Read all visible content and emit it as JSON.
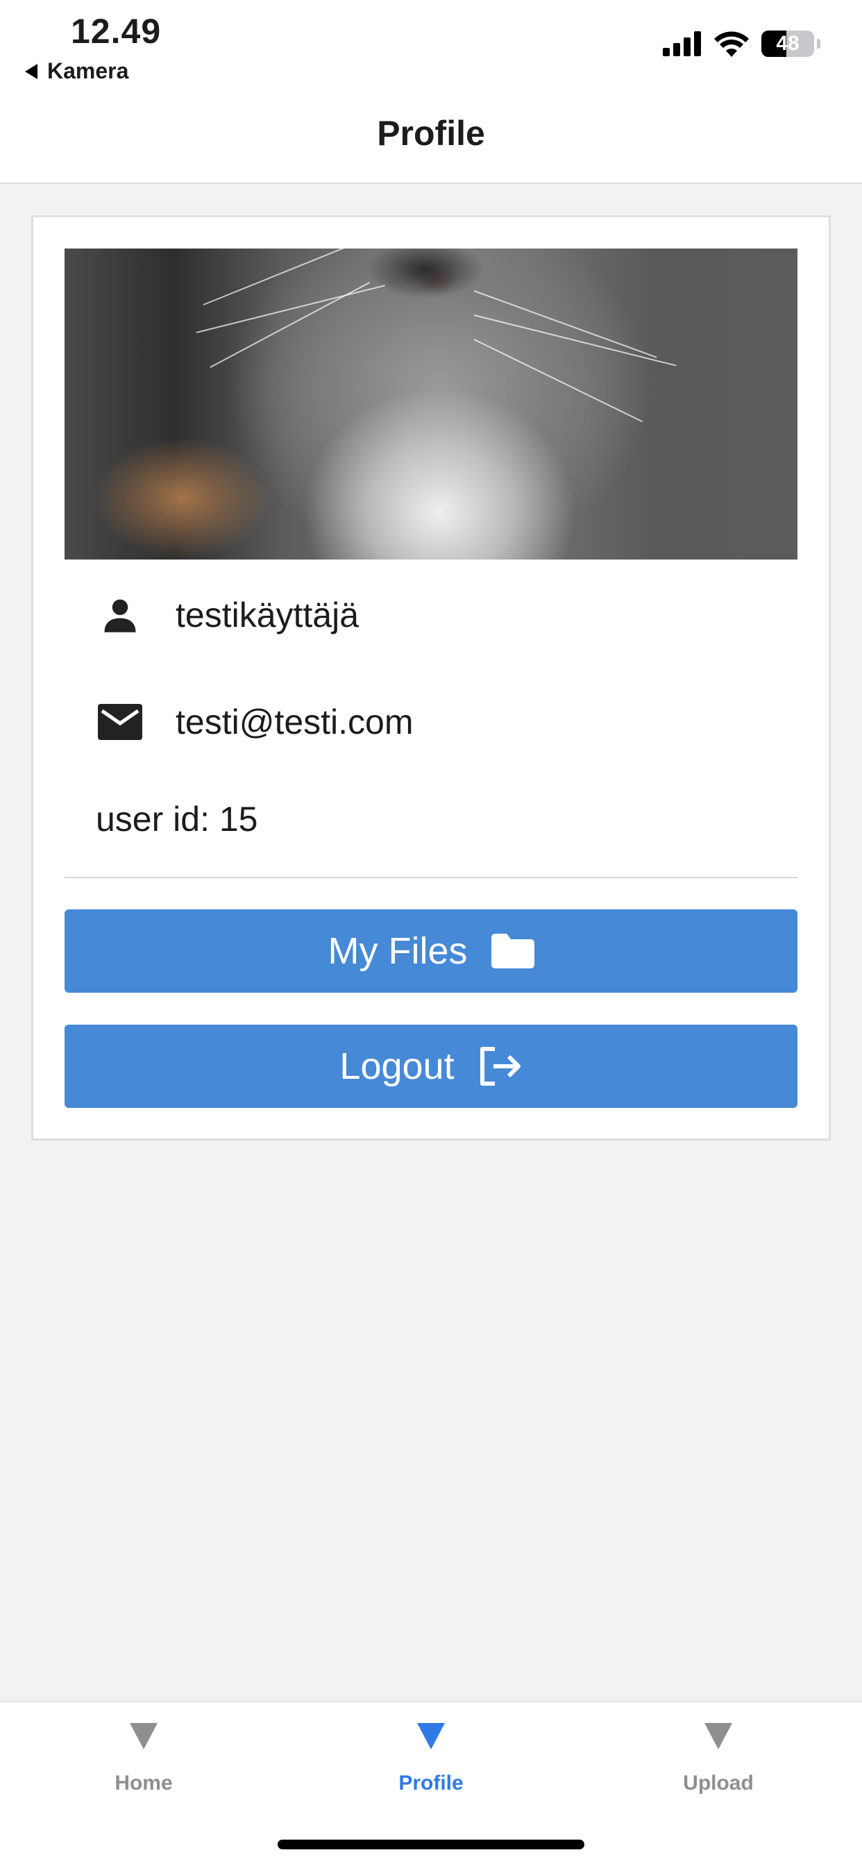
{
  "status_bar": {
    "time": "12.49",
    "back_app": "Kamera",
    "battery_percent": "48",
    "battery_level": 0.48
  },
  "header": {
    "title": "Profile"
  },
  "profile": {
    "username": "testikäyttäjä",
    "email": "testi@testi.com",
    "user_id_text": "user id: 15"
  },
  "buttons": {
    "my_files_label": "My Files",
    "logout_label": "Logout"
  },
  "tabs": [
    {
      "label": "Home",
      "active": false
    },
    {
      "label": "Profile",
      "active": true
    },
    {
      "label": "Upload",
      "active": false
    }
  ],
  "colors": {
    "accent": "#4689d7",
    "active_tab": "#2f7ae5",
    "inactive_tab": "#8e8e93",
    "background": "#f2f2f2"
  },
  "icons": {
    "user": "person-icon",
    "email": "envelope-icon",
    "files": "folder-icon",
    "logout": "logout-icon",
    "tab": "triangle-down-icon"
  }
}
